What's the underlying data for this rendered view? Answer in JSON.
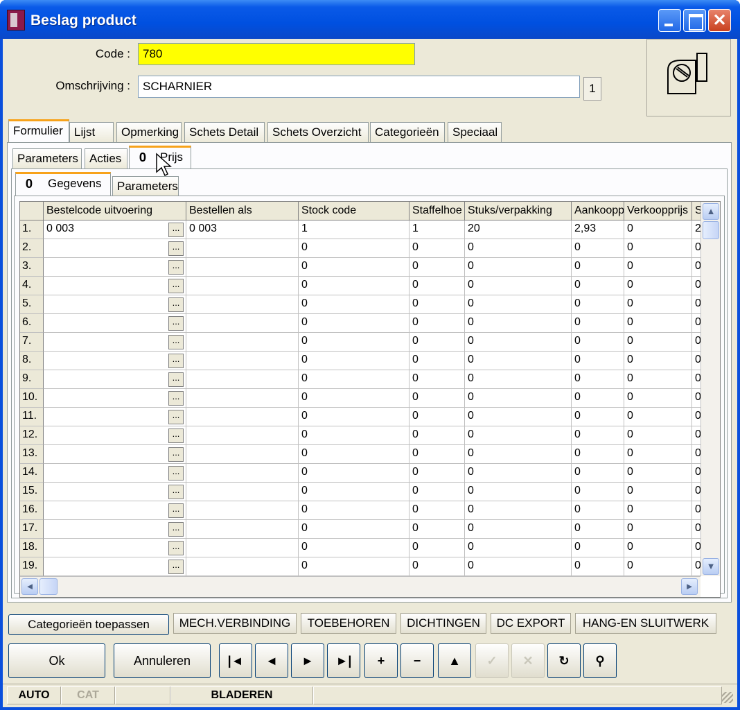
{
  "window": {
    "title": "Beslag product"
  },
  "form": {
    "code_label": "Code :",
    "code_value": "780",
    "omschrijving_label": "Omschrijving :",
    "omschrijving_value": "SCHARNIER",
    "counter": "1"
  },
  "main_tabs": [
    "Formulier",
    "Lijst",
    "Opmerking",
    "Schets Detail",
    "Schets Overzicht",
    "Categorieën",
    "Speciaal"
  ],
  "sub_tabs": [
    "Parameters",
    "Acties",
    "Prijs"
  ],
  "inner_tabs": [
    "Gegevens",
    "Parameters"
  ],
  "grid": {
    "columns": [
      "Bestelcode uitvoering",
      "Bestellen als",
      "Stock code",
      "Staffelhoe",
      "Stuks/verpakking",
      "Aankoopp",
      "Verkoopprijs",
      "S"
    ],
    "ellipsis": "...",
    "rows": [
      {
        "num": "1.",
        "cells": [
          "0 003",
          "0 003",
          "1",
          "1",
          "20",
          "2,93",
          "0",
          "2"
        ]
      },
      {
        "num": "2.",
        "cells": [
          "",
          "",
          "0",
          "0",
          "0",
          "0",
          "0",
          "0"
        ]
      },
      {
        "num": "3.",
        "cells": [
          "",
          "",
          "0",
          "0",
          "0",
          "0",
          "0",
          "0"
        ]
      },
      {
        "num": "4.",
        "cells": [
          "",
          "",
          "0",
          "0",
          "0",
          "0",
          "0",
          "0"
        ]
      },
      {
        "num": "5.",
        "cells": [
          "",
          "",
          "0",
          "0",
          "0",
          "0",
          "0",
          "0"
        ]
      },
      {
        "num": "6.",
        "cells": [
          "",
          "",
          "0",
          "0",
          "0",
          "0",
          "0",
          "0"
        ]
      },
      {
        "num": "7.",
        "cells": [
          "",
          "",
          "0",
          "0",
          "0",
          "0",
          "0",
          "0"
        ]
      },
      {
        "num": "8.",
        "cells": [
          "",
          "",
          "0",
          "0",
          "0",
          "0",
          "0",
          "0"
        ]
      },
      {
        "num": "9.",
        "cells": [
          "",
          "",
          "0",
          "0",
          "0",
          "0",
          "0",
          "0"
        ]
      },
      {
        "num": "10.",
        "cells": [
          "",
          "",
          "0",
          "0",
          "0",
          "0",
          "0",
          "0"
        ]
      },
      {
        "num": "11.",
        "cells": [
          "",
          "",
          "0",
          "0",
          "0",
          "0",
          "0",
          "0"
        ]
      },
      {
        "num": "12.",
        "cells": [
          "",
          "",
          "0",
          "0",
          "0",
          "0",
          "0",
          "0"
        ]
      },
      {
        "num": "13.",
        "cells": [
          "",
          "",
          "0",
          "0",
          "0",
          "0",
          "0",
          "0"
        ]
      },
      {
        "num": "14.",
        "cells": [
          "",
          "",
          "0",
          "0",
          "0",
          "0",
          "0",
          "0"
        ]
      },
      {
        "num": "15.",
        "cells": [
          "",
          "",
          "0",
          "0",
          "0",
          "0",
          "0",
          "0"
        ]
      },
      {
        "num": "16.",
        "cells": [
          "",
          "",
          "0",
          "0",
          "0",
          "0",
          "0",
          "0"
        ]
      },
      {
        "num": "17.",
        "cells": [
          "",
          "",
          "0",
          "0",
          "0",
          "0",
          "0",
          "0"
        ]
      },
      {
        "num": "18.",
        "cells": [
          "",
          "",
          "0",
          "0",
          "0",
          "0",
          "0",
          "0"
        ]
      },
      {
        "num": "19.",
        "cells": [
          "",
          "",
          "0",
          "0",
          "0",
          "0",
          "0",
          "0"
        ]
      }
    ]
  },
  "category_buttons": [
    "Categorieën toepassen",
    "MECH.VERBINDING",
    "TOEBEHOREN",
    "DICHTINGEN",
    "DC EXPORT",
    "HANG-EN SLUITWERK"
  ],
  "actions": {
    "ok": "Ok",
    "annuleren": "Annuleren"
  },
  "nav_buttons": [
    {
      "icon": "first-record-icon",
      "glyph": "|◄",
      "enabled": true
    },
    {
      "icon": "previous-record-icon",
      "glyph": "◄",
      "enabled": true
    },
    {
      "icon": "next-record-icon",
      "glyph": "►",
      "enabled": true
    },
    {
      "icon": "last-record-icon",
      "glyph": "►|",
      "enabled": true
    },
    {
      "icon": "add-icon",
      "glyph": "+",
      "enabled": true
    },
    {
      "icon": "remove-icon",
      "glyph": "−",
      "enabled": true
    },
    {
      "icon": "up-arrow-icon",
      "glyph": "▲",
      "enabled": true
    },
    {
      "icon": "checkmark-icon",
      "glyph": "✓",
      "enabled": false
    },
    {
      "icon": "cancel-x-icon",
      "glyph": "✕",
      "enabled": false
    },
    {
      "icon": "refresh-icon",
      "glyph": "↻",
      "enabled": true
    },
    {
      "icon": "binoculars-icon",
      "glyph": "⚲",
      "enabled": true
    }
  ],
  "status_bar": [
    "AUTO",
    "CAT",
    "",
    "BLADEREN",
    ""
  ],
  "colors": {
    "title_bar": "#0a5ae8",
    "code_field_bg": "#ffff00",
    "active_tab_accent": "#f7a21a",
    "dialog_bg": "#ece9d8"
  }
}
